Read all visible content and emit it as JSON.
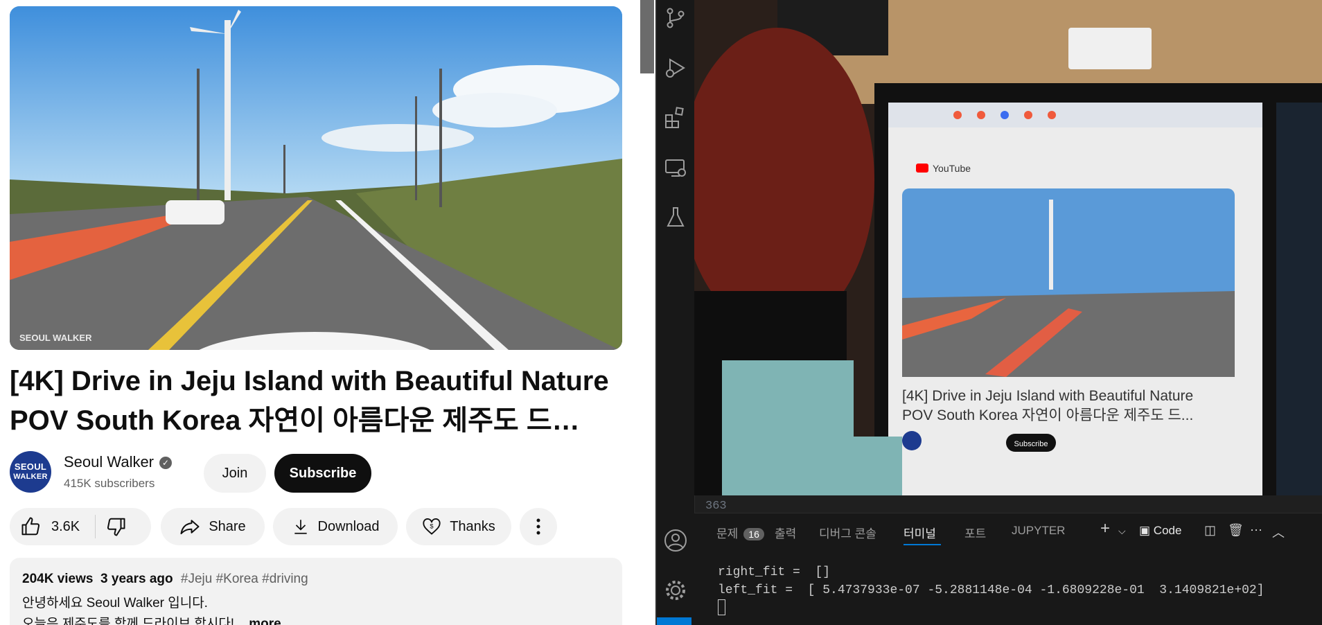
{
  "youtube": {
    "video": {
      "watermark": "SEOUL WALKER"
    },
    "title_line1": "[4K] Drive in Jeju Island with Beautiful Nature",
    "title_line2": "POV South Korea 자연이 아름다운 제주도 드…",
    "channel": {
      "avatar_line1": "SEOUL",
      "avatar_line2": "WALKER",
      "name": "Seoul Walker",
      "subscribers": "415K subscribers",
      "join_label": "Join",
      "subscribe_label": "Subscribe"
    },
    "actions": {
      "likes": "3.6K",
      "share": "Share",
      "download": "Download",
      "thanks": "Thanks"
    },
    "description": {
      "views": "204K views",
      "age": "3 years ago",
      "tags": "#Jeju #Korea #driving",
      "line1": "안녕하세요 Seoul Walker 입니다.",
      "line2": "오늘은 제주도를 함께 드라이브 합시다! ",
      "more": "...more"
    }
  },
  "camera_feed": {
    "inner_title_line1": "[4K] Drive in Jeju Island with Beautiful Nature",
    "inner_title_line2": "POV South Korea 자연이 아름다운 제주도 드...",
    "inner_logo": "YouTube",
    "inner_subscribe": "Subscribe"
  },
  "vscode": {
    "line_number": "363",
    "panel_tabs": {
      "problems": "문제",
      "problems_count": "16",
      "output": "출력",
      "debug_console": "디버그 콘솔",
      "terminal": "터미널",
      "ports": "포트",
      "jupyter": "JUPYTER",
      "code": "Code"
    },
    "terminal_lines": [
      "right_fit =  []",
      "left_fit =  [ 5.4737933e-07 -5.2881148e-04 -1.6809228e-01  3.1409821e+02]"
    ],
    "colors": {
      "accent": "#0078d4",
      "background": "#1f1f1f"
    }
  }
}
